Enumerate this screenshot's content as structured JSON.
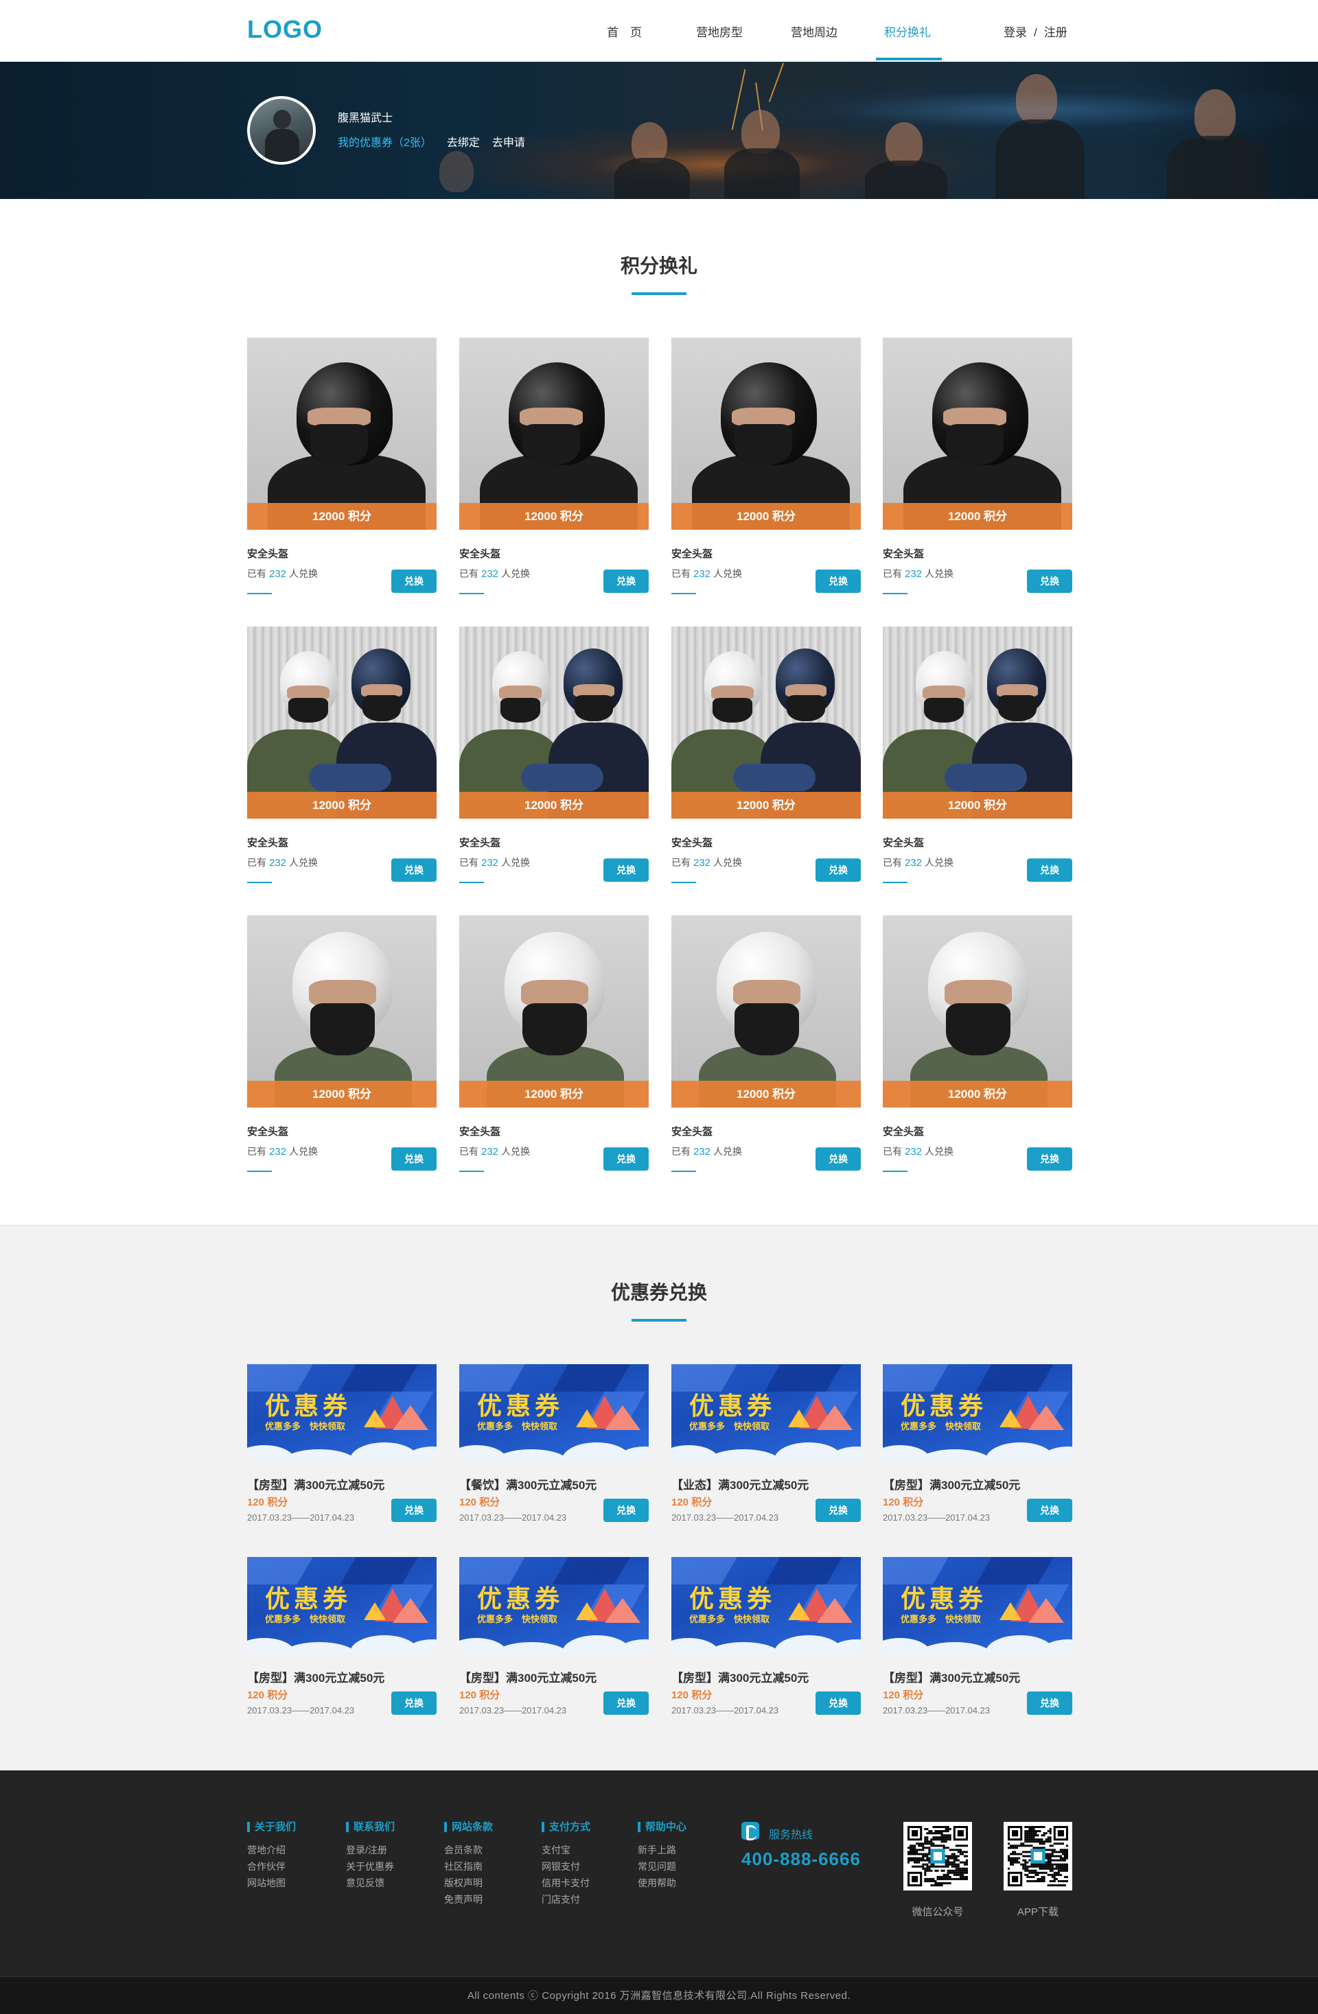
{
  "header": {
    "logo": "LOGO",
    "nav": [
      {
        "label": "首　页",
        "active": false
      },
      {
        "label": "营地房型",
        "active": false
      },
      {
        "label": "营地周边",
        "active": false
      },
      {
        "label": "积分换礼",
        "active": true
      }
    ],
    "login": "登录",
    "separator": "/",
    "register": "注册"
  },
  "hero": {
    "username": "腹黑猫武士",
    "my_coupons": "我的优惠券（2张）",
    "bind": "去绑定",
    "apply": "去申请"
  },
  "points_section": {
    "title": "积分换礼",
    "products": [
      {
        "image": "black-helmet",
        "points": "12000 积分",
        "name": "安全头盔",
        "count_prefix": "已有",
        "count": "232",
        "count_suffix": "人兑换",
        "button": "兑换"
      },
      {
        "image": "black-helmet",
        "points": "12000 积分",
        "name": "安全头盔",
        "count_prefix": "已有",
        "count": "232",
        "count_suffix": "人兑换",
        "button": "兑换"
      },
      {
        "image": "black-helmet",
        "points": "12000 积分",
        "name": "安全头盔",
        "count_prefix": "已有",
        "count": "232",
        "count_suffix": "人兑换",
        "button": "兑换"
      },
      {
        "image": "black-helmet",
        "points": "12000 积分",
        "name": "安全头盔",
        "count_prefix": "已有",
        "count": "232",
        "count_suffix": "人兑换",
        "button": "兑换"
      },
      {
        "image": "two-riders",
        "points": "12000 积分",
        "name": "安全头盔",
        "count_prefix": "已有",
        "count": "232",
        "count_suffix": "人兑换",
        "button": "兑换"
      },
      {
        "image": "two-riders",
        "points": "12000 积分",
        "name": "安全头盔",
        "count_prefix": "已有",
        "count": "232",
        "count_suffix": "人兑换",
        "button": "兑换"
      },
      {
        "image": "two-riders",
        "points": "12000 积分",
        "name": "安全头盔",
        "count_prefix": "已有",
        "count": "232",
        "count_suffix": "人兑换",
        "button": "兑换"
      },
      {
        "image": "two-riders",
        "points": "12000 积分",
        "name": "安全头盔",
        "count_prefix": "已有",
        "count": "232",
        "count_suffix": "人兑换",
        "button": "兑换"
      },
      {
        "image": "white-helmet",
        "points": "12000 积分",
        "name": "安全头盔",
        "count_prefix": "已有",
        "count": "232",
        "count_suffix": "人兑换",
        "button": "兑换"
      },
      {
        "image": "white-helmet",
        "points": "12000 积分",
        "name": "安全头盔",
        "count_prefix": "已有",
        "count": "232",
        "count_suffix": "人兑换",
        "button": "兑换"
      },
      {
        "image": "white-helmet",
        "points": "12000 积分",
        "name": "安全头盔",
        "count_prefix": "已有",
        "count": "232",
        "count_suffix": "人兑换",
        "button": "兑换"
      },
      {
        "image": "white-helmet",
        "points": "12000 积分",
        "name": "安全头盔",
        "count_prefix": "已有",
        "count": "232",
        "count_suffix": "人兑换",
        "button": "兑换"
      }
    ]
  },
  "coupon_section": {
    "title": "优惠券兑换",
    "coupons": [
      {
        "banner_title": "优惠券",
        "banner_sub": "优惠多多　快快领取",
        "name": "【房型】满300元立减50元",
        "points": "120 积分",
        "date": "2017.03.23——2017.04.23",
        "button": "兑换"
      },
      {
        "banner_title": "优惠券",
        "banner_sub": "优惠多多　快快领取",
        "name": "【餐饮】满300元立减50元",
        "points": "120 积分",
        "date": "2017.03.23——2017.04.23",
        "button": "兑换"
      },
      {
        "banner_title": "优惠券",
        "banner_sub": "优惠多多　快快领取",
        "name": "【业态】满300元立减50元",
        "points": "120 积分",
        "date": "2017.03.23——2017.04.23",
        "button": "兑换"
      },
      {
        "banner_title": "优惠券",
        "banner_sub": "优惠多多　快快领取",
        "name": "【房型】满300元立减50元",
        "points": "120 积分",
        "date": "2017.03.23——2017.04.23",
        "button": "兑换"
      },
      {
        "banner_title": "优惠券",
        "banner_sub": "优惠多多　快快领取",
        "name": "【房型】满300元立减50元",
        "points": "120 积分",
        "date": "2017.03.23——2017.04.23",
        "button": "兑换"
      },
      {
        "banner_title": "优惠券",
        "banner_sub": "优惠多多　快快领取",
        "name": "【房型】满300元立减50元",
        "points": "120 积分",
        "date": "2017.03.23——2017.04.23",
        "button": "兑换"
      },
      {
        "banner_title": "优惠券",
        "banner_sub": "优惠多多　快快领取",
        "name": "【房型】满300元立减50元",
        "points": "120 积分",
        "date": "2017.03.23——2017.04.23",
        "button": "兑换"
      },
      {
        "banner_title": "优惠券",
        "banner_sub": "优惠多多　快快领取",
        "name": "【房型】满300元立减50元",
        "points": "120 积分",
        "date": "2017.03.23——2017.04.23",
        "button": "兑换"
      }
    ]
  },
  "footer": {
    "columns": [
      {
        "title": "关于我们",
        "links": [
          "营地介绍",
          "合作伙伴",
          "网站地图"
        ]
      },
      {
        "title": "联系我们",
        "links": [
          "登录/注册",
          "关于优惠券",
          "意见反馈"
        ]
      },
      {
        "title": "网站条款",
        "links": [
          "会员条款",
          "社区指南",
          "版权声明",
          "免责声明"
        ]
      },
      {
        "title": "支付方式",
        "links": [
          "支付宝",
          "网银支付",
          "信用卡支付",
          "门店支付"
        ]
      },
      {
        "title": "帮助中心",
        "links": [
          "新手上路",
          "常见问题",
          "使用帮助"
        ]
      }
    ],
    "hotline_label": "服务热线",
    "hotline_number": "400-888-6666",
    "qr_wechat_label": "微信公众号",
    "qr_app_label": "APP下载",
    "copyright": "All contents ⓒ Copyright 2016 万洲嘉智信息技术有限公司.All Rights Reserved."
  },
  "colors": {
    "accent": "#1a9fc8",
    "points_orange": "#e8803a",
    "footer_bg": "#242424",
    "coupon_bg": "#f2f2f2"
  }
}
